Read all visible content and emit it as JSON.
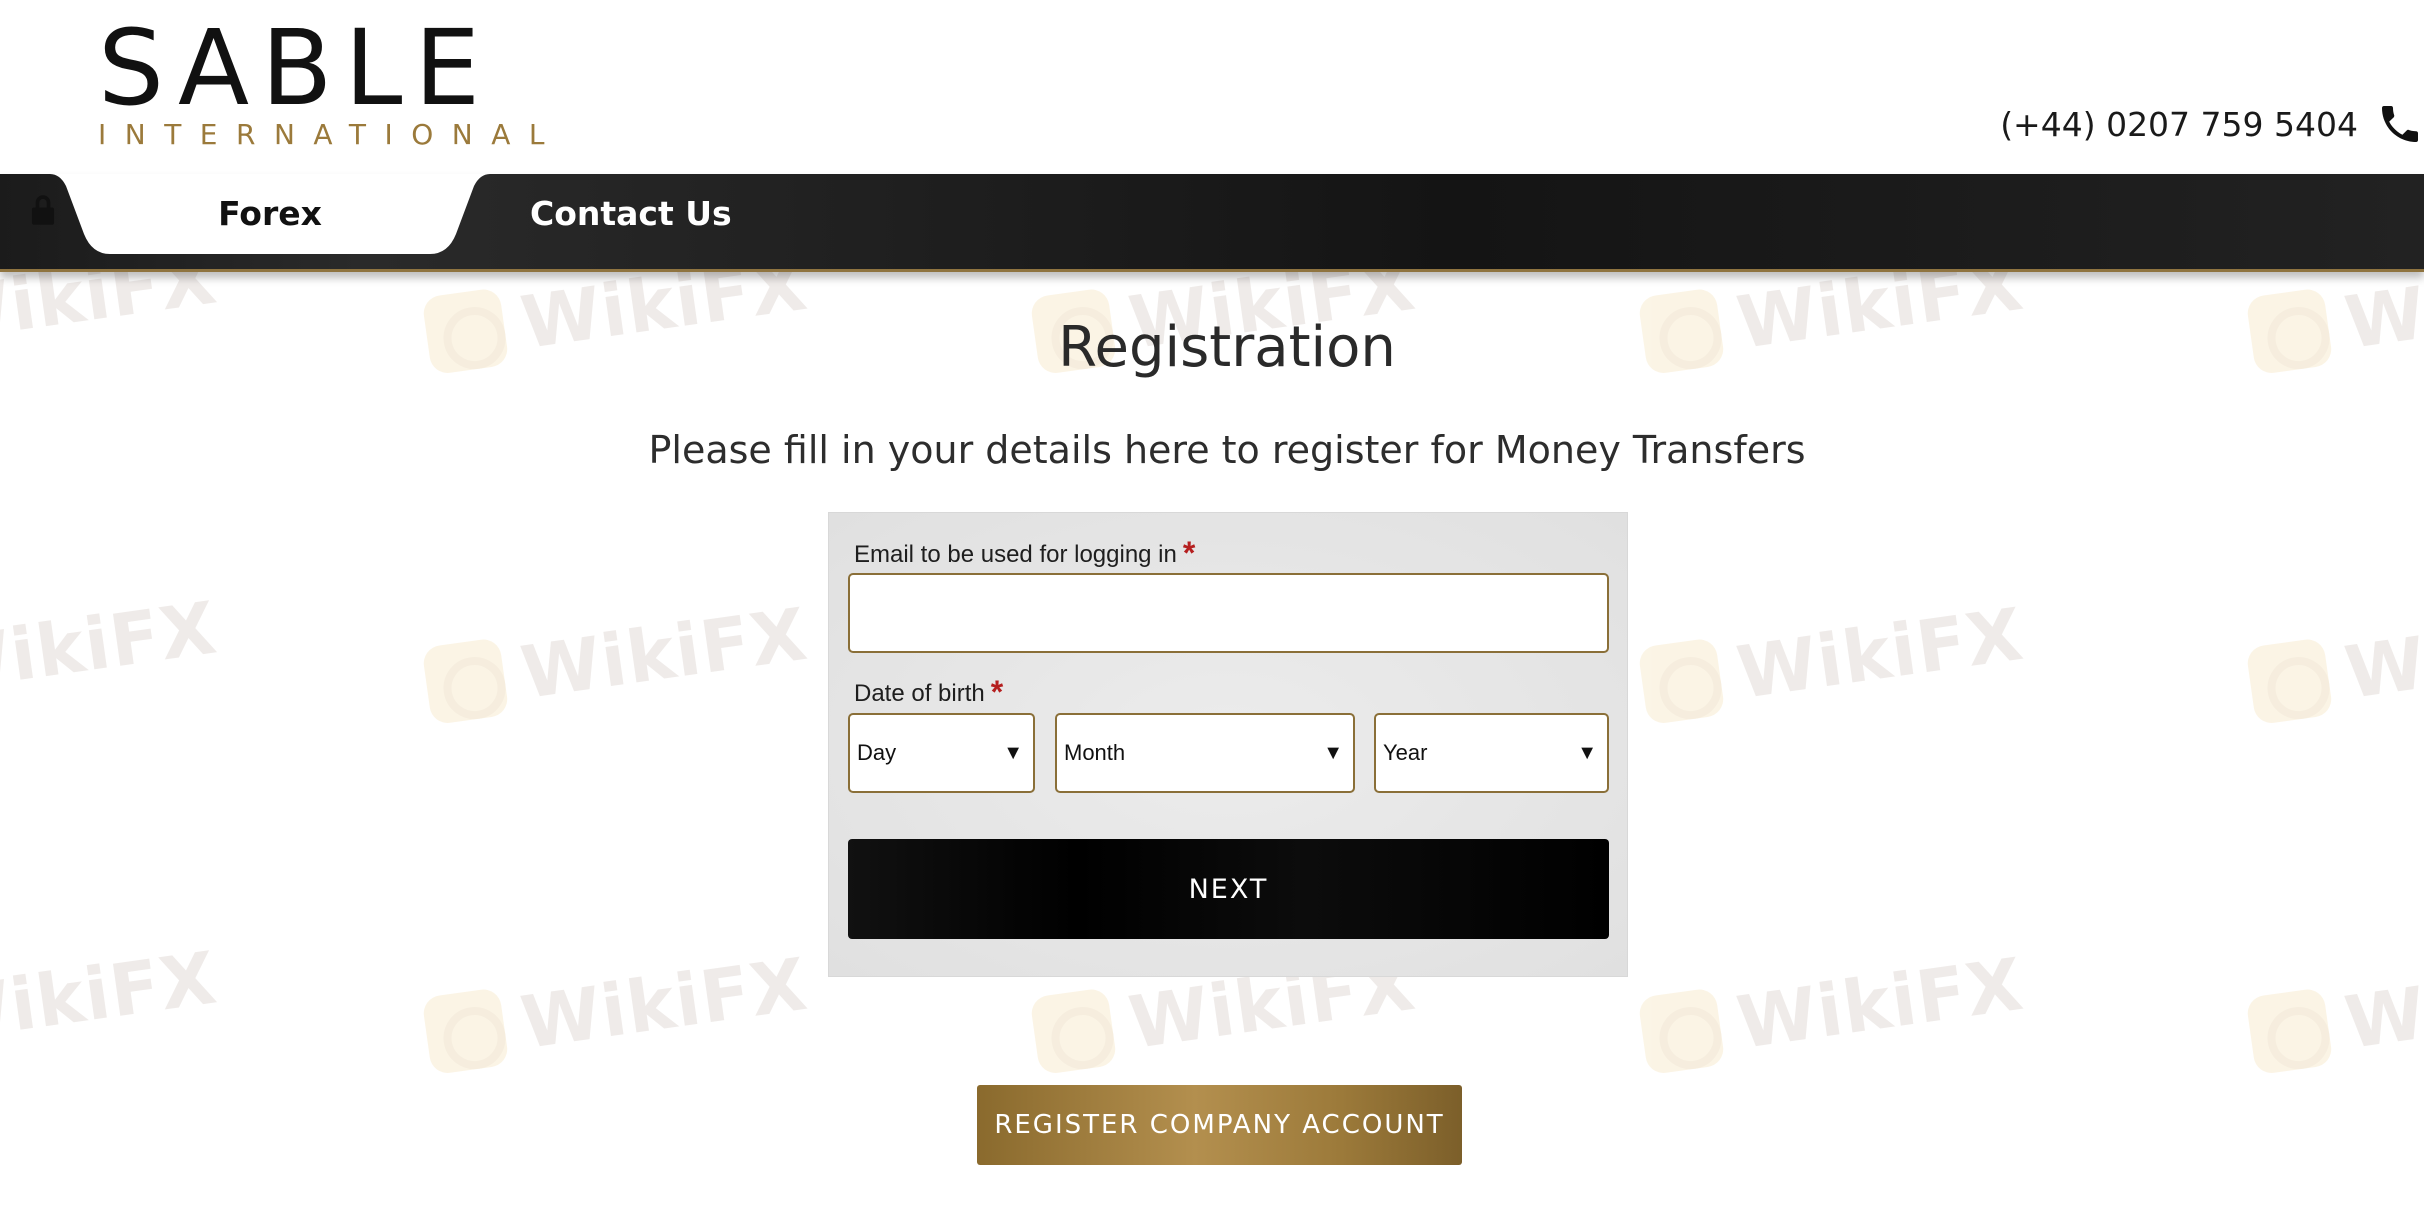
{
  "brand": {
    "name": "SABLE",
    "tagline": "INTERNATIONAL"
  },
  "header": {
    "phone": "(+44) 0207 759 5404",
    "phone_icon": "phone-icon"
  },
  "nav": {
    "tabs": [
      {
        "label": "Forex",
        "icon": "lock-icon",
        "active": true
      },
      {
        "label": "Contact Us",
        "active": false
      }
    ]
  },
  "main": {
    "title": "Registration",
    "subtitle": "Please fill in your details here to register for Money Transfers",
    "form": {
      "email_label": "Email to be used for logging in",
      "email_value": "",
      "dob_label": "Date of birth",
      "required_marker": "*",
      "day_placeholder": "Day",
      "month_placeholder": "Month",
      "year_placeholder": "Year",
      "caret": "▼",
      "next_label": "NEXT"
    },
    "company_button_label": "REGISTER COMPANY ACCOUNT"
  },
  "watermark": {
    "text": "WikiFX"
  },
  "colors": {
    "accent_gold": "#9b7a3b",
    "nav_bg": "#1b1b1b",
    "required_red": "#b51f1f"
  }
}
